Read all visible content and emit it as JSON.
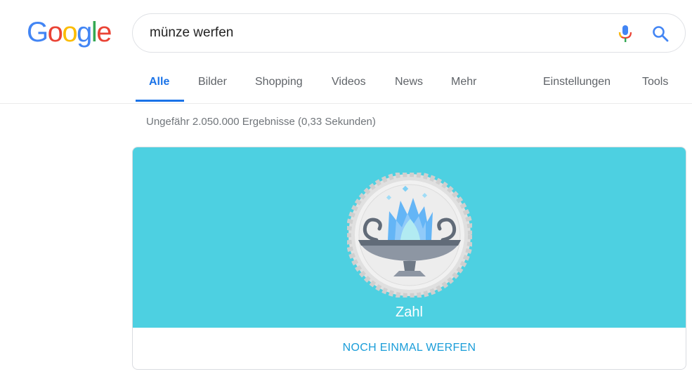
{
  "logo": {
    "letters": [
      {
        "char": "G",
        "color": "#4285F4"
      },
      {
        "char": "o",
        "color": "#EA4335"
      },
      {
        "char": "o",
        "color": "#FBBC05"
      },
      {
        "char": "g",
        "color": "#4285F4"
      },
      {
        "char": "l",
        "color": "#34A853"
      },
      {
        "char": "e",
        "color": "#EA4335"
      }
    ]
  },
  "search": {
    "value": "münze werfen",
    "mic_icon": "microphone-icon",
    "search_icon": "magnifier-icon"
  },
  "tabs": [
    {
      "label": "Alle",
      "active": true
    },
    {
      "label": "Bilder",
      "active": false
    },
    {
      "label": "Shopping",
      "active": false
    },
    {
      "label": "Videos",
      "active": false
    },
    {
      "label": "News",
      "active": false
    },
    {
      "label": "Mehr",
      "active": false
    }
  ],
  "tools": {
    "settings_label": "Einstellungen",
    "tools_label": "Tools"
  },
  "result_stats": "Ungefähr 2.050.000 Ergebnisse (0,33 Sekunden)",
  "coin_card": {
    "background_color": "#4dd0e1",
    "result": "Zahl",
    "flip_label": "NOCH EINMAL WERFEN",
    "coin_icon": "coin-bowl-flame-icon"
  }
}
